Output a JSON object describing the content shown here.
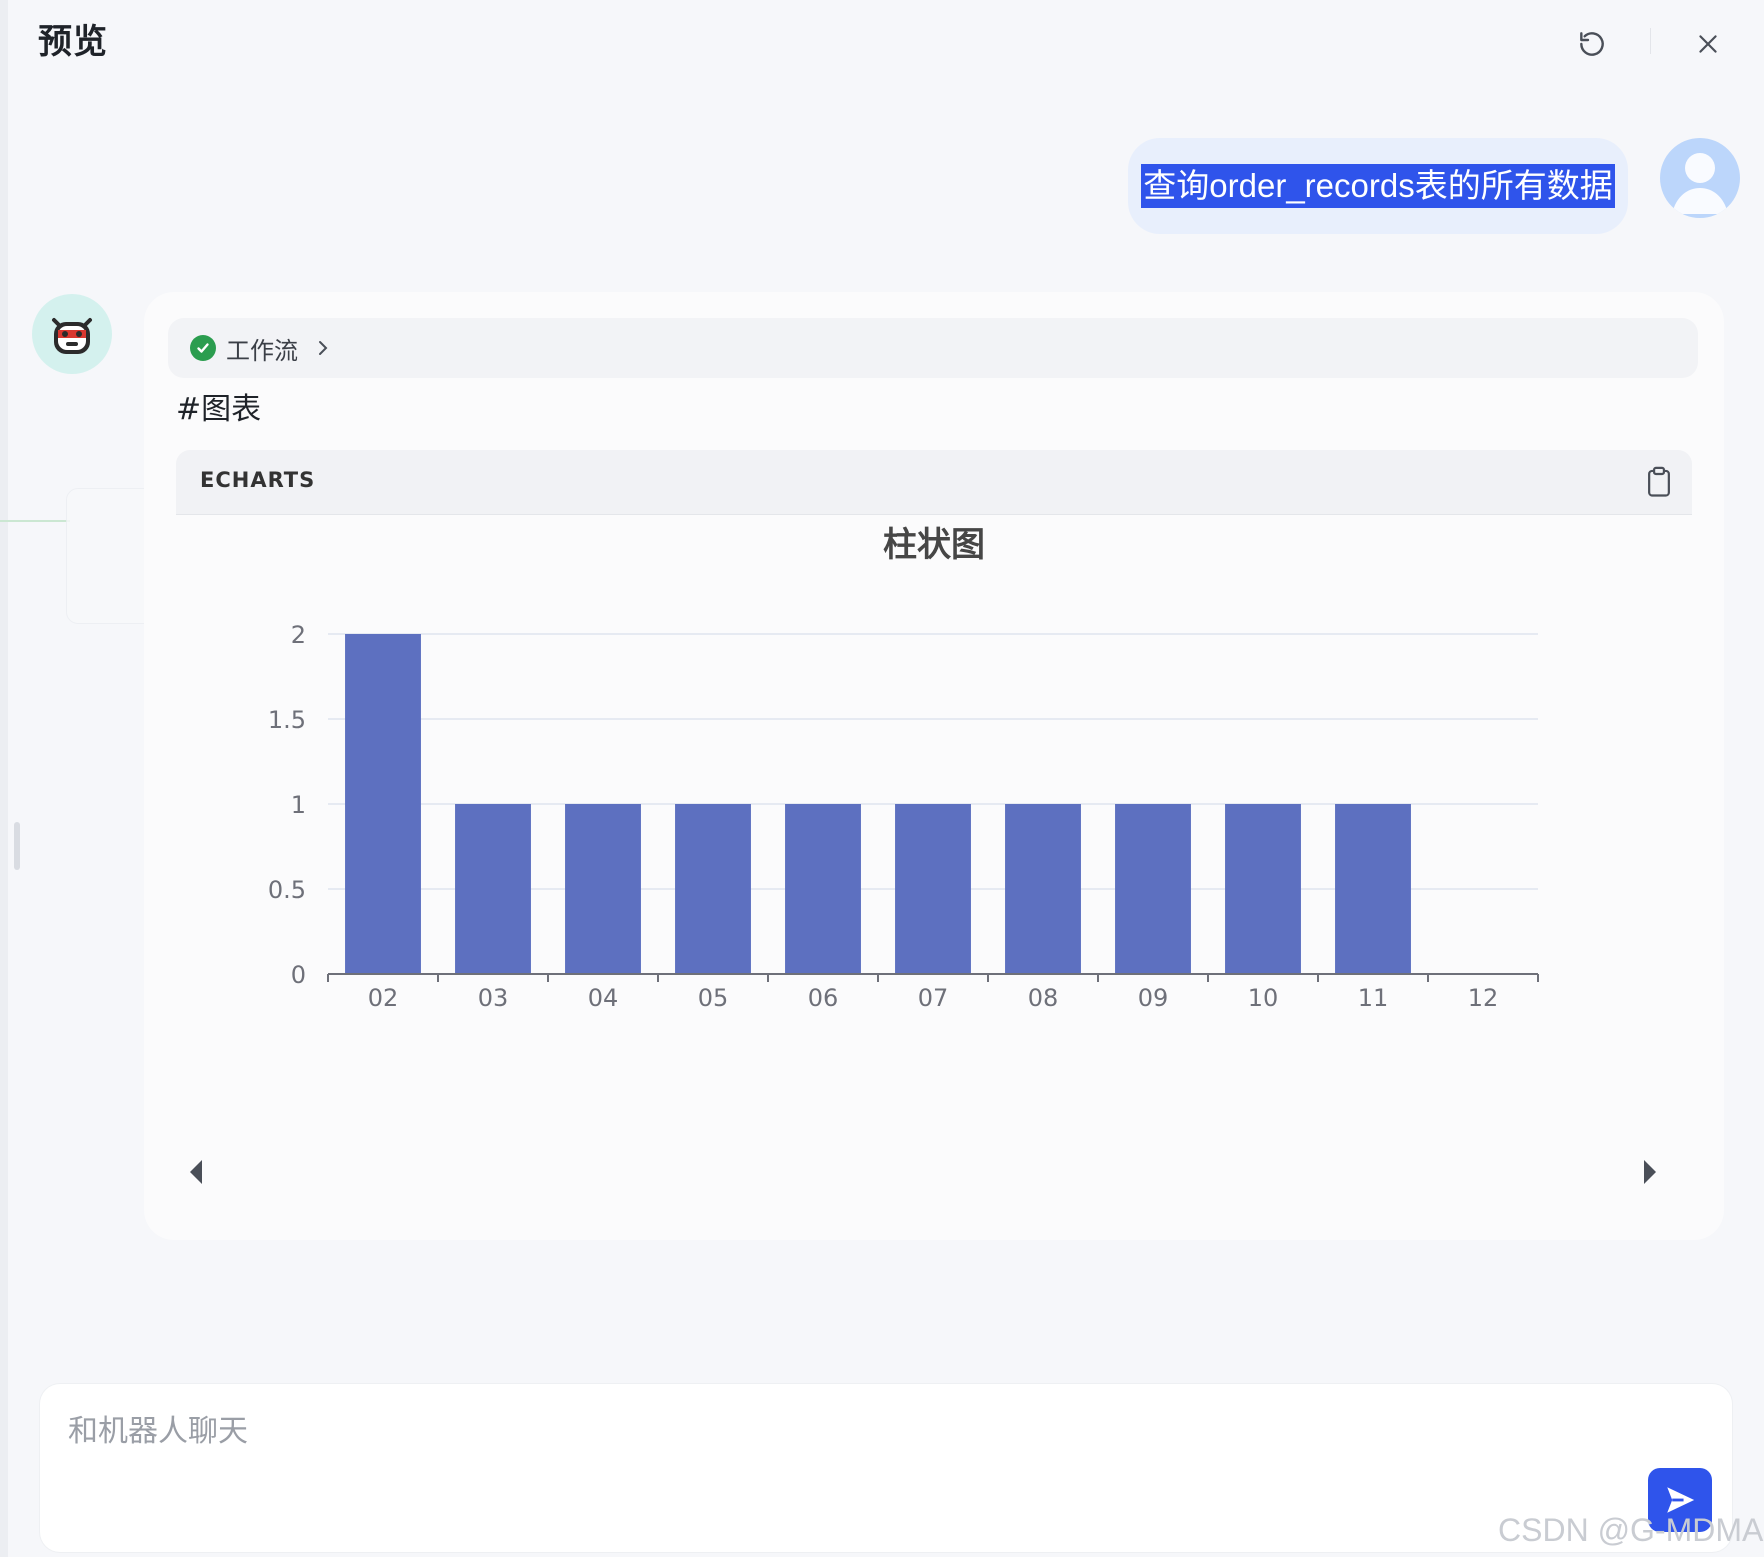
{
  "header": {
    "title": "预览",
    "reload_icon": "reload-icon",
    "close_icon": "close-icon"
  },
  "user_message": {
    "text": "查询order_records表的所有数据"
  },
  "bot_message": {
    "workflow_label": "工作流",
    "text": "#图表",
    "chart_block_label": "ECHARTS"
  },
  "input": {
    "placeholder": "和机器人聊天"
  },
  "watermark": "CSDN @G-MDMA",
  "colors": {
    "accent": "#2f54eb",
    "bar": "#5d70c0",
    "success": "#2b9d4f"
  },
  "chart_data": {
    "type": "bar",
    "title": "柱状图",
    "categories": [
      "02",
      "03",
      "04",
      "05",
      "06",
      "07",
      "08",
      "09",
      "10",
      "11",
      "12"
    ],
    "values": [
      2,
      1,
      1,
      1,
      1,
      1,
      1,
      1,
      1,
      1,
      0
    ],
    "ylim": [
      0,
      2
    ],
    "yticks": [
      0,
      0.5,
      1,
      1.5,
      2
    ],
    "grid": true,
    "bar_color": "#5d70c0"
  }
}
